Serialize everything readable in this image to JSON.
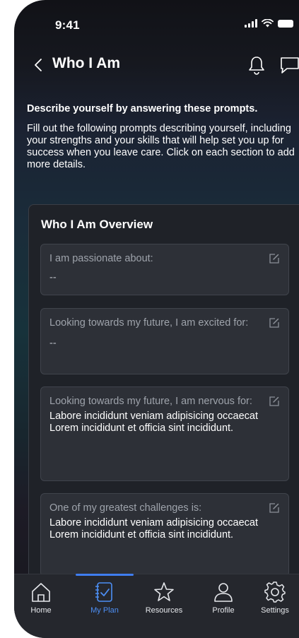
{
  "status_bar": {
    "time": "9:41"
  },
  "header": {
    "title": "Who I Am"
  },
  "intro": {
    "heading": "Describe yourself by answering these prompts.",
    "body": "Fill out the following prompts describing yourself, including your strengths and your skills that will help set you up for success when you leave care. Click on each section to add more details."
  },
  "overview": {
    "title": "Who I Am Overview",
    "prompts": [
      {
        "label": "I am passionate about:",
        "value": "--"
      },
      {
        "label": "Looking towards my future, I am excited for:",
        "value": "--"
      },
      {
        "label": "Looking towards my future, I am nervous for:",
        "value": "Labore incididunt veniam adipisicing occaecat Lorem incididunt et officia sint incididunt."
      },
      {
        "label": "One of my greatest challenges is:",
        "value": "Labore incididunt veniam adipisicing occaecat Lorem incididunt et officia sint incididunt."
      }
    ]
  },
  "tabs": [
    {
      "label": "Home",
      "icon": "home-icon"
    },
    {
      "label": "My Plan",
      "icon": "plan-checklist-icon",
      "active": true
    },
    {
      "label": "Resources",
      "icon": "star-icon"
    },
    {
      "label": "Profile",
      "icon": "person-icon"
    },
    {
      "label": "Settings",
      "icon": "gear-icon"
    }
  ],
  "colors": {
    "accent": "#3f7df0",
    "card_bg": "#1f2228",
    "prompt_bg": "#2d3037",
    "tabbar_bg": "#25272d"
  }
}
